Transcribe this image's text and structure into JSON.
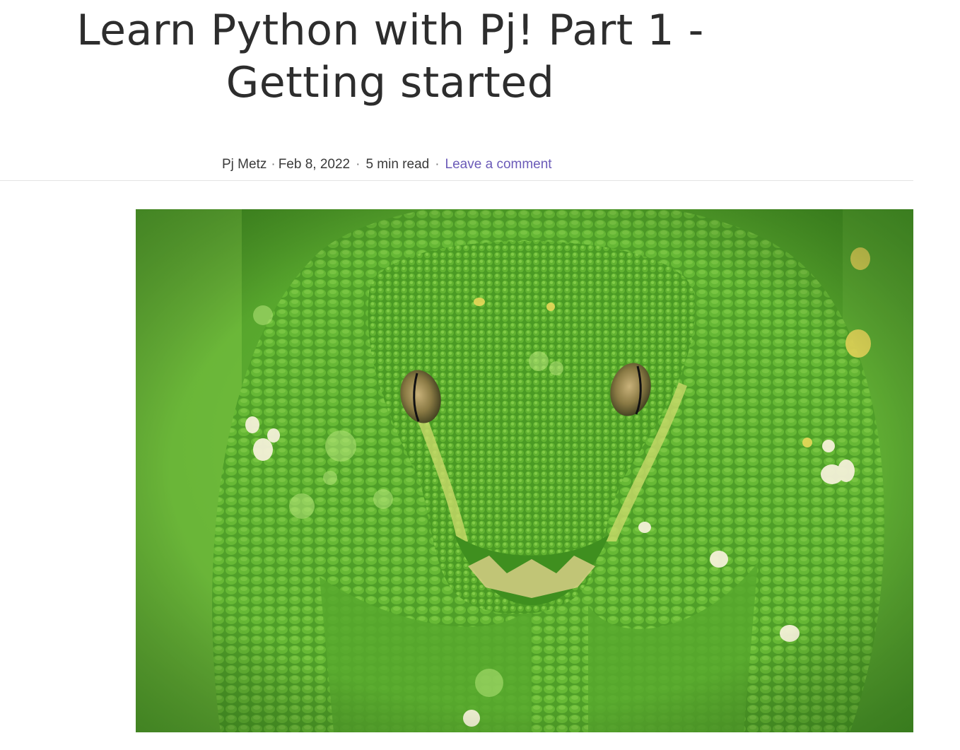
{
  "article": {
    "title": "Learn Python with Pj! Part 1 - Getting started",
    "author": "Pj Metz",
    "date": "Feb 8, 2022",
    "read_time": "5 min read",
    "comment_link": "Leave a comment",
    "separator": "·"
  },
  "hero_image": {
    "subject": "green tree python coiled, head facing camera",
    "colors": {
      "base": "#5aa82e",
      "light": "#a6dc5c",
      "dark": "#2f7a18",
      "eye": "#8a7a44"
    }
  },
  "colors": {
    "link": "#6b5bb8",
    "text": "#2d2d2d",
    "divider": "#e3e3e3"
  }
}
